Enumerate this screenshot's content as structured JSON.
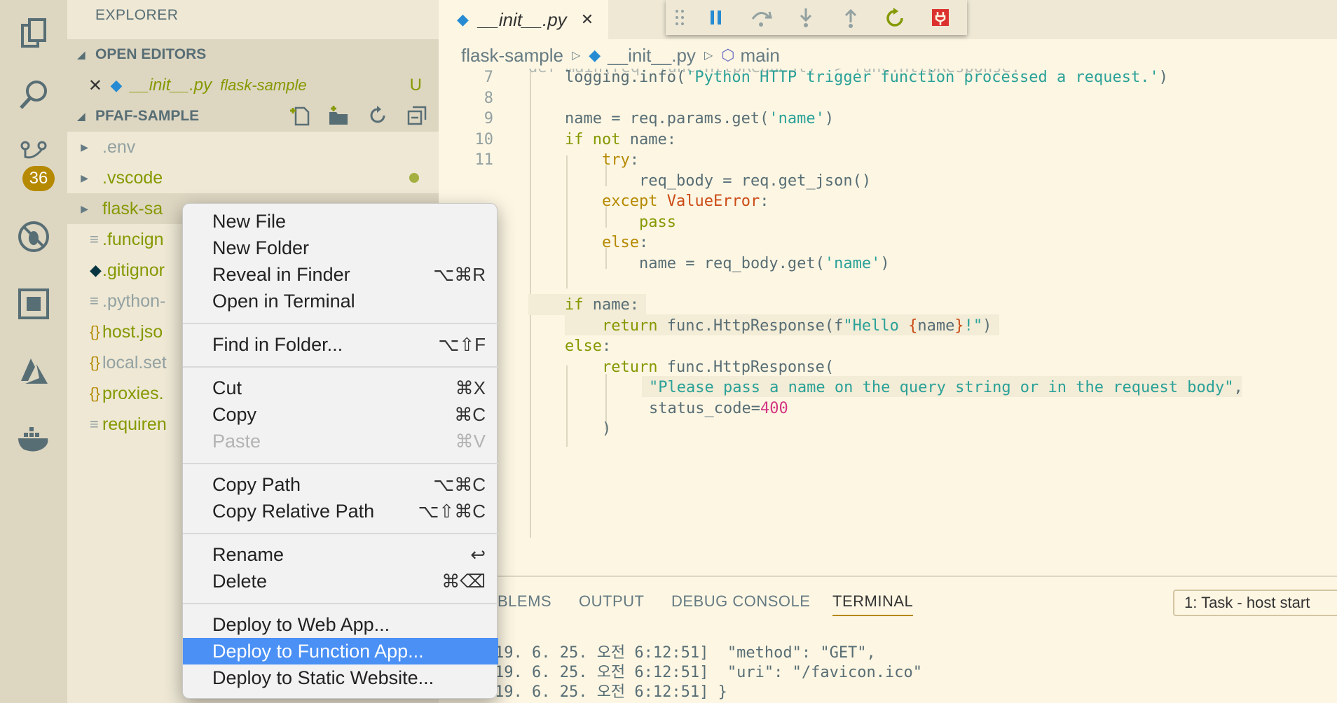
{
  "activitybar": {
    "items": [
      "explorer-icon",
      "search-icon",
      "source-control-icon",
      "debug-icon",
      "extensions-icon",
      "azure-icon",
      "docker-icon"
    ],
    "scm_badge": "36"
  },
  "sidebar": {
    "title": "EXPLORER",
    "open_editors": {
      "header": "OPEN EDITORS",
      "file": "__init__.py",
      "folder": "flask-sample",
      "status": "U"
    },
    "workspace": {
      "header": "PFAF-SAMPLE",
      "items": [
        {
          "name": ".env",
          "type": "folder"
        },
        {
          "name": ".vscode",
          "type": "folder"
        },
        {
          "name": "flask-sa",
          "type": "folder"
        },
        {
          "name": ".funcign",
          "type": "file-lines"
        },
        {
          "name": ".gitignor",
          "type": "file-git"
        },
        {
          "name": ".python-",
          "type": "file-lines"
        },
        {
          "name": "host.jso",
          "type": "file-json"
        },
        {
          "name": "local.set",
          "type": "file-json"
        },
        {
          "name": "proxies.",
          "type": "file-json"
        },
        {
          "name": "requiren",
          "type": "file-lines"
        }
      ]
    }
  },
  "editor": {
    "tab": {
      "label": "__init__.py",
      "close": "✕"
    },
    "breadcrumb": [
      "flask-sample",
      "__init__.py",
      "main"
    ],
    "line_numbers": [
      "7",
      "8",
      "9",
      "10",
      "11"
    ]
  },
  "code": {
    "l7a": "logging.info(",
    "l7b": "'Python HTTP trigger function processed a request.'",
    "l7c": ")",
    "l9a": "name = req.params.get(",
    "l9b": "'name'",
    "l9c": ")",
    "l10a": "if not",
    "l10b": " name:",
    "l11a": "try",
    "l11b": ":",
    "l12": "req_body = req.get_json()",
    "l13a": "except",
    "l13b": "ValueError",
    "l13c": ":",
    "l14": "pass",
    "l15a": "else",
    "l15b": ":",
    "l16a": "name = req_body.get(",
    "l16b": "'name'",
    "l16c": ")",
    "l18a": "if",
    "l18b": " name:",
    "l19a": "return",
    "l19b": " func.HttpResponse(f",
    "l19c": "\"Hello ",
    "l19d": "{",
    "l19e": "name",
    "l19f": "}",
    "l19g": "!\"",
    "l19h": ")",
    "l20a": "else",
    "l20b": ":",
    "l21a": "return",
    "l21b": " func.HttpResponse(",
    "l22a": "\"Please pass a name on the query string or in the request body\"",
    "l22b": ",",
    "l23a": "status_code=",
    "l23b": "400",
    "l24": ")"
  },
  "panel": {
    "tabs": [
      "BLEMS",
      "OUTPUT",
      "DEBUG CONSOLE",
      "TERMINAL"
    ],
    "task_select": "1: Task - host start",
    "terminal_lines": [
      "19. 6. 25. 오전 6:12:51]  \"method\": \"GET\",",
      "19. 6. 25. 오전 6:12:51]  \"uri\": \"/favicon.ico\"",
      "19. 6. 25. 오전 6:12:51] }"
    ]
  },
  "context_menu": {
    "items": [
      {
        "label": "New File",
        "key": ""
      },
      {
        "label": "New Folder",
        "key": ""
      },
      {
        "label": "Reveal in Finder",
        "key": "⌥⌘R"
      },
      {
        "label": "Open in Terminal",
        "key": ""
      },
      {
        "label": "Find in Folder...",
        "key": "⌥⇧F"
      },
      {
        "label": "Cut",
        "key": "⌘X"
      },
      {
        "label": "Copy",
        "key": "⌘C"
      },
      {
        "label": "Paste",
        "key": "⌘V"
      },
      {
        "label": "Copy Path",
        "key": "⌥⌘C"
      },
      {
        "label": "Copy Relative Path",
        "key": "⌥⇧⌘C"
      },
      {
        "label": "Rename",
        "key": "↩"
      },
      {
        "label": "Delete",
        "key": "⌘⌫"
      },
      {
        "label": "Deploy to Web App...",
        "key": ""
      },
      {
        "label": "Deploy to Function App...",
        "key": ""
      },
      {
        "label": "Deploy to Static Website...",
        "key": ""
      }
    ]
  },
  "colors": {
    "accent": "#b58900",
    "selection": "#4a90f5",
    "string": "#2aa198",
    "keyword": "#859900"
  }
}
